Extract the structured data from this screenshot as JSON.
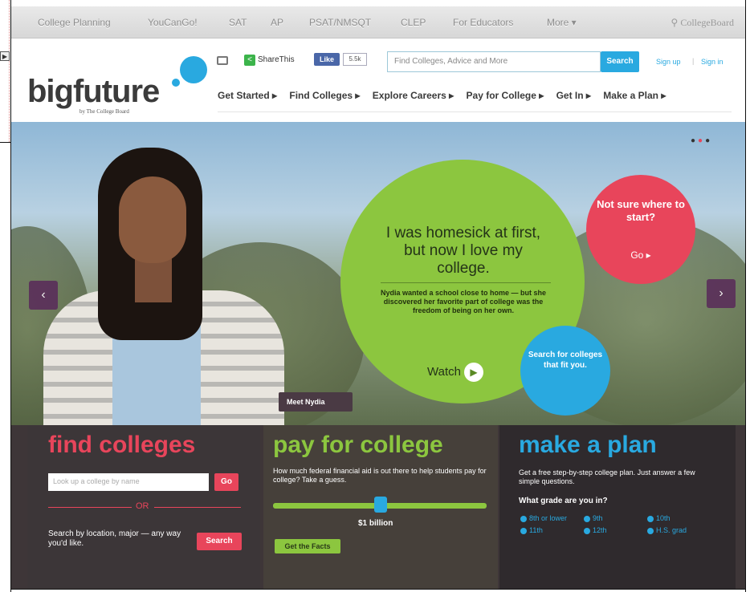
{
  "topnav": {
    "items": [
      "College Planning",
      "YouCanGo!",
      "SAT",
      "AP",
      "PSAT/NMSQT",
      "CLEP",
      "For Educators",
      "More ▾"
    ],
    "brand": "CollegeBoard"
  },
  "header": {
    "logo": "bigfuture",
    "logo_sub": "by The College Board",
    "share_label": "ShareThis",
    "fb_like": "Like",
    "fb_count": "5.5k",
    "search_placeholder": "Find Colleges, Advice and More",
    "search_button": "Search",
    "sign_up": "Sign up",
    "separator": "|",
    "sign_in": "Sign in",
    "nav": [
      "Get Started ▸",
      "Find Colleges ▸",
      "Explore Careers ▸",
      "Pay for College ▸",
      "Get In ▸",
      "Make a Plan ▸"
    ]
  },
  "hero": {
    "quote": "I was homesick at first, but now I love my college.",
    "body": "Nydia wanted a school close to home — but she discovered her favorite part of college was the freedom of being on her own.",
    "watch_label": "Watch",
    "meet_tag": "Meet Nydia",
    "pink_text": "Not sure where to start?",
    "pink_go": "Go ▸",
    "blue_text": "Search for colleges that fit you.",
    "dots": [
      "●",
      "●",
      "●"
    ]
  },
  "find": {
    "title": "find colleges",
    "input_placeholder": "Look up a college by name",
    "go_button": "Go",
    "or_label": "OR",
    "location_text": "Search by location, major — any way you'd like.",
    "search_button": "Search"
  },
  "pay": {
    "title": "pay for college",
    "question": "How much federal financial aid is out there to help students pay for college? Take a guess.",
    "slider_value": "$1 billion",
    "facts_button": "Get the Facts"
  },
  "plan": {
    "title": "make a plan",
    "description": "Get a free step-by-step college plan. Just answer a few simple questions.",
    "grade_question": "What grade are you in?",
    "grades": [
      "8th or lower",
      "9th",
      "10th",
      "11th",
      "12th",
      "H.S. grad"
    ]
  },
  "colors": {
    "pink": "#e8455b",
    "green": "#8cc63f",
    "blue": "#29a9e0"
  }
}
